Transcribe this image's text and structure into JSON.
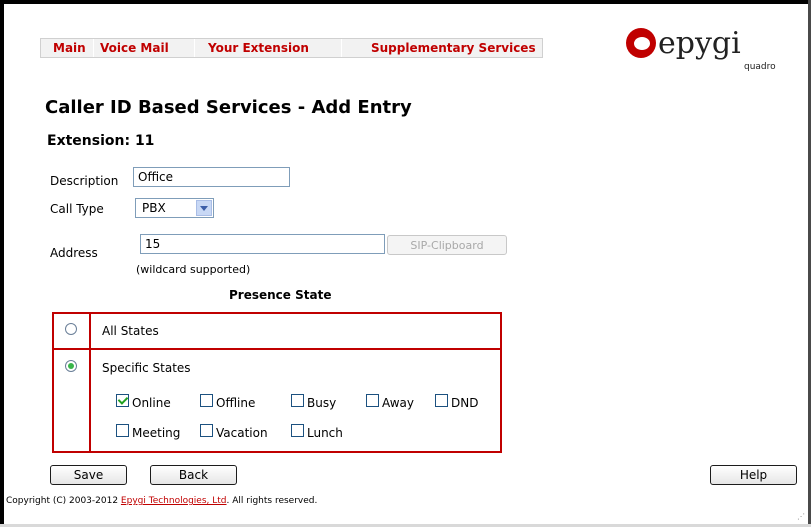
{
  "menu": {
    "items": [
      "Main",
      "Voice Mail",
      "Your Extension",
      "Supplementary Services"
    ]
  },
  "logo": {
    "brand": "epygi",
    "sub": "quadro"
  },
  "page": {
    "title": "Caller ID Based Services - Add Entry",
    "extension_label": "Extension: 11"
  },
  "form": {
    "description_label": "Description",
    "description_value": "Office",
    "call_type_label": "Call Type",
    "call_type_value": "PBX",
    "address_label": "Address",
    "address_value": "15",
    "clipboard_button": "SIP-Clipboard",
    "wildcard_hint": "(wildcard supported)"
  },
  "presence": {
    "section_title": "Presence State",
    "all_states_label": "All States",
    "specific_states_label": "Specific States",
    "all_states_selected": false,
    "specific_states_selected": true,
    "states": [
      {
        "label": "Online",
        "checked": true
      },
      {
        "label": "Offline",
        "checked": false
      },
      {
        "label": "Busy",
        "checked": false
      },
      {
        "label": "Away",
        "checked": false
      },
      {
        "label": "DND",
        "checked": false
      },
      {
        "label": "Meeting",
        "checked": false
      },
      {
        "label": "Vacation",
        "checked": false
      },
      {
        "label": "Lunch",
        "checked": false
      }
    ]
  },
  "buttons": {
    "save": "Save",
    "back": "Back",
    "help": "Help"
  },
  "footer": {
    "prefix": "Copyright (C) 2003-2012 ",
    "link": "Epygi Technologies, Ltd",
    "suffix": ". All rights reserved."
  },
  "colors": {
    "accent": "#c00000",
    "check": "#21a121"
  }
}
